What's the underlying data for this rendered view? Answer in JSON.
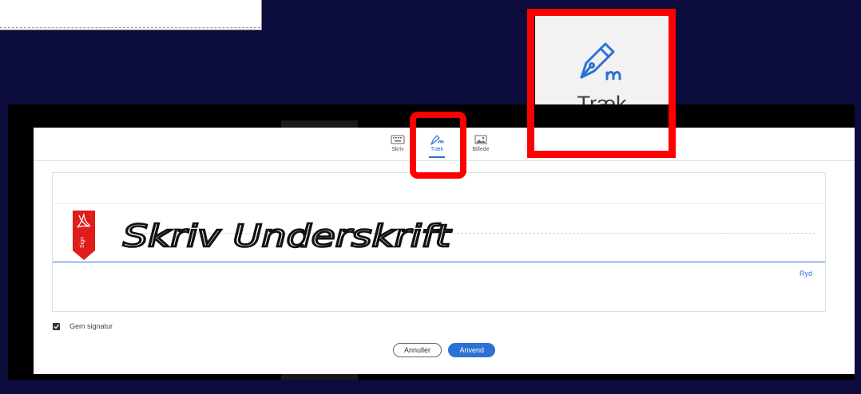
{
  "tabs": [
    {
      "label": "Skriv",
      "icon": "keyboard-icon"
    },
    {
      "label": "Træk",
      "icon": "pen-draw-icon"
    },
    {
      "label": "Billede",
      "icon": "image-icon"
    }
  ],
  "active_tab": "Træk",
  "zoom_callout": {
    "label": "Træk",
    "icon": "pen-draw-icon"
  },
  "signature": {
    "ink_text": "Skriv Underskrift",
    "sign_flag_label": "Sign",
    "clear_label": "Ryd"
  },
  "save_signature": {
    "label": "Gem signatur",
    "checked": true
  },
  "buttons": {
    "cancel_label": "Annuller",
    "apply_label": "Anvend"
  },
  "colors": {
    "background": "#0b0c3c",
    "accent": "#2c72d4",
    "highlight_frame": "#ff0000",
    "acrobat_red": "#e21b1b"
  }
}
